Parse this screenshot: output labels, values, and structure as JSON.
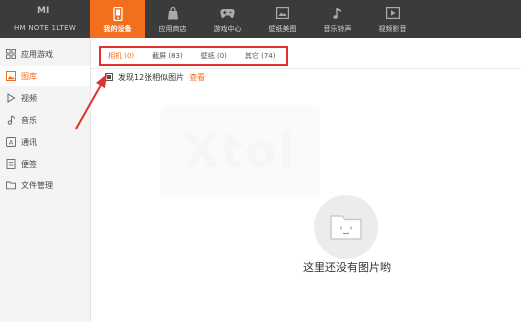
{
  "device": {
    "logo": "MI",
    "name": "HM NOTE 1LTEW"
  },
  "nav": [
    {
      "label": "我的设备",
      "icon": "phone-icon",
      "active": true
    },
    {
      "label": "应用商店",
      "icon": "shopping-bag-icon",
      "active": false
    },
    {
      "label": "游戏中心",
      "icon": "gamepad-icon",
      "active": false
    },
    {
      "label": "壁纸美图",
      "icon": "wallpaper-icon",
      "active": false
    },
    {
      "label": "音乐铃声",
      "icon": "music-note-icon",
      "active": false
    },
    {
      "label": "视频影音",
      "icon": "video-icon",
      "active": false
    }
  ],
  "sidebar": {
    "items": [
      {
        "label": "应用游戏",
        "icon": "app-grid-icon"
      },
      {
        "label": "图库",
        "icon": "gallery-icon",
        "active": true
      },
      {
        "label": "视频",
        "icon": "play-icon"
      },
      {
        "label": "音乐",
        "icon": "music-note-icon"
      },
      {
        "label": "通讯",
        "icon": "contacts-icon"
      },
      {
        "label": "便签",
        "icon": "note-icon"
      },
      {
        "label": "文件管理",
        "icon": "folder-icon"
      }
    ]
  },
  "subtabs": [
    {
      "label": "相机 (0)",
      "active": true
    },
    {
      "label": "截屏 (83)",
      "active": false
    },
    {
      "label": "壁纸 (0)",
      "active": false
    },
    {
      "label": "其它 (74)",
      "active": false
    }
  ],
  "similar": {
    "text": "发现12张相似图片",
    "link": "查看"
  },
  "empty": {
    "message": "这里还没有图片哟"
  },
  "watermark": "Xtol",
  "colors": {
    "accent": "#f36e1d",
    "topbar": "#3b3b3b",
    "highlight_box": "#e0322f"
  }
}
